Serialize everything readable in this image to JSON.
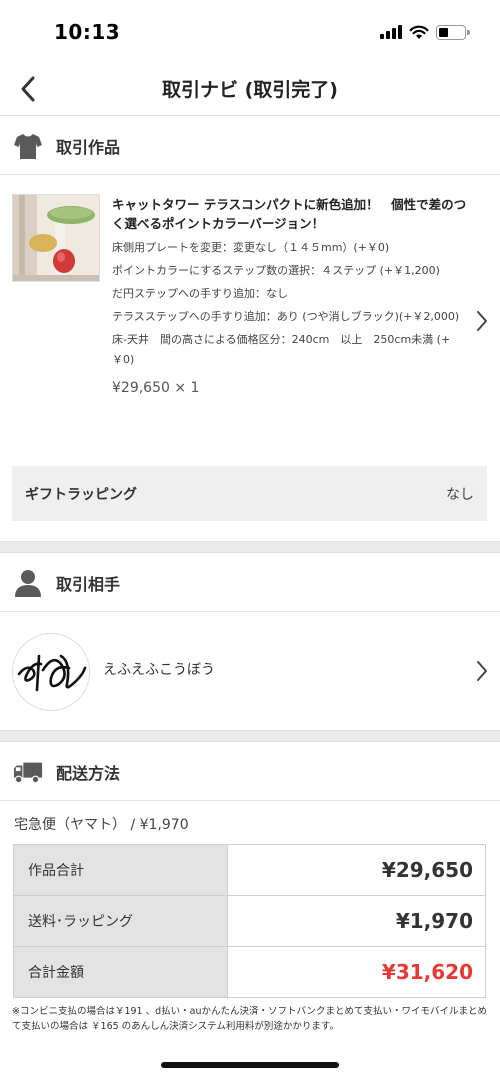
{
  "status_bar": {
    "time": "10:13"
  },
  "nav": {
    "title": "取引ナビ (取引完了)"
  },
  "product_section": {
    "title": "取引作品",
    "product_title": "キャットタワー テラスコンパクトに新色追加！　個性で差のつく選べるポイントカラーバージョン！",
    "options": [
      "床側用プレートを変更：変更なし（１４５mm）(+￥0)",
      "ポイントカラーにするステップ数の選択：４ステップ (+￥1,200)",
      "だ円ステップへの手すり追加：なし",
      "テラスステップへの手すり追加：あり (つや消しブラック)(+￥2,000)",
      "床-天井　間の高さによる価格区分：240cm　以上　250cm未満 (+￥0)"
    ],
    "price_line": "¥29,650 × 1"
  },
  "gift": {
    "label": "ギフトラッピング",
    "value": "なし"
  },
  "partner_section": {
    "title": "取引相手",
    "name": "えふえふこうぼう"
  },
  "shipping_section": {
    "title": "配送方法",
    "method": "宅急便（ヤマト） / ¥1,970",
    "summary": [
      {
        "label": "作品合計",
        "value": "¥29,650"
      },
      {
        "label": "送料･ラッピング",
        "value": "¥1,970"
      },
      {
        "label": "合計金額",
        "value": "¥31,620"
      }
    ],
    "note": "※コンビニ支払の場合は￥191 、d払い・auかんたん決済・ソフトバンクまとめて支払い・ワイモバイルまとめて支払いの場合は ￥165 のあんしん決済システム利用料が別途かかります。"
  },
  "colors": {
    "total_red": "#e53935",
    "section_gap": "#ebebeb",
    "label_bg": "#e3e3e3"
  }
}
